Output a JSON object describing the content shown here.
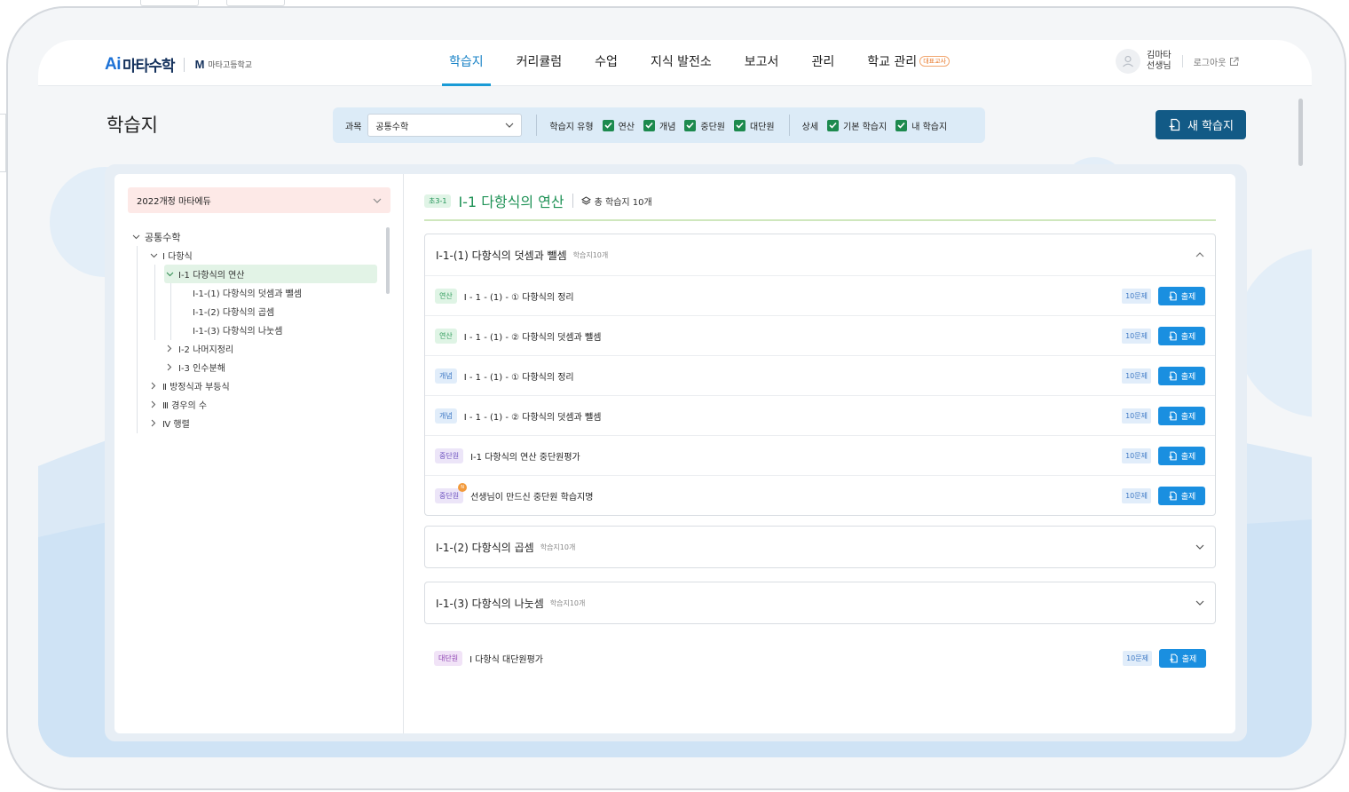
{
  "brand": {
    "logo_ai": "Ai",
    "logo_name": "마타수학",
    "school_mark": "M",
    "school_name": "마타고등학교"
  },
  "nav": [
    {
      "label": "학습지",
      "active": true
    },
    {
      "label": "커리큘럼"
    },
    {
      "label": "수업"
    },
    {
      "label": "지식 발전소"
    },
    {
      "label": "보고서"
    },
    {
      "label": "관리"
    },
    {
      "label": "학교 관리",
      "badge": "대표교사"
    }
  ],
  "user": {
    "name_line1": "김마타",
    "name_line2": "선생님",
    "logout": "로그아웃"
  },
  "page": {
    "title": "학습지",
    "new_button": "새 학습지"
  },
  "filters": {
    "subject_label": "과목",
    "subject_value": "공통수학",
    "type_label": "학습지 유형",
    "types": [
      "연산",
      "개념",
      "중단원",
      "대단원"
    ],
    "detail_label": "상세",
    "details": [
      "기본 학습지",
      "내 학습지"
    ]
  },
  "sidebar": {
    "curriculum": "2022개정 마타에듀",
    "tree": [
      {
        "label": "공통수학",
        "level": 0,
        "state": "open"
      },
      {
        "label": "Ⅰ 다항식",
        "level": 1,
        "state": "open"
      },
      {
        "label": "Ⅰ-1 다항식의 연산",
        "level": 2,
        "state": "open",
        "selected": true
      },
      {
        "label": "Ⅰ-1-(1) 다항식의 덧셈과 뺄셈",
        "level": 3
      },
      {
        "label": "Ⅰ-1-(2) 다항식의 곱셈",
        "level": 3
      },
      {
        "label": "Ⅰ-1-(3) 다항식의 나눗셈",
        "level": 3
      },
      {
        "label": "Ⅰ-2 나머지정리",
        "level": 2,
        "state": "closed"
      },
      {
        "label": "Ⅰ-3 인수분해",
        "level": 2,
        "state": "closed"
      },
      {
        "label": "Ⅱ 방정식과 부등식",
        "level": 1,
        "state": "closed"
      },
      {
        "label": "Ⅲ 경우의 수",
        "level": 1,
        "state": "closed"
      },
      {
        "label": "Ⅳ 행렬",
        "level": 1,
        "state": "closed"
      }
    ]
  },
  "unit": {
    "grade_tag": "초3-1",
    "title": "Ⅰ-1 다항식의 연산",
    "total": "총 학습지 10개"
  },
  "sections": [
    {
      "title": "Ⅰ-1-(1) 다항식의 덧셈과 뺄셈",
      "count": "학습지10개",
      "expanded": true,
      "rows": [
        {
          "tag": "연산",
          "title": "Ⅰ - 1 - (1) - ① 다항식의 정리",
          "qcount": "10문제",
          "button": "출제"
        },
        {
          "tag": "연산",
          "title": "Ⅰ - 1 - (1) - ② 다항식의 덧셈과 뺄셈",
          "qcount": "10문제",
          "button": "출제"
        },
        {
          "tag": "개념",
          "title": "Ⅰ - 1 - (1) - ① 다항식의 정리",
          "qcount": "10문제",
          "button": "출제"
        },
        {
          "tag": "개념",
          "title": "Ⅰ - 1 - (1) - ② 다항식의 덧셈과 뺄셈",
          "qcount": "10문제",
          "button": "출제"
        },
        {
          "tag": "중단원",
          "title": "Ⅰ-1 다항식의 연산 중단원평가",
          "qcount": "10문제",
          "button": "출제"
        },
        {
          "tag": "중단원",
          "title": "선생님이 만드신 중단원 학습지명",
          "qcount": "10문제",
          "button": "출제",
          "new_badge": "N"
        }
      ]
    },
    {
      "title": "Ⅰ-1-(2) 다항식의 곱셈",
      "count": "학습지10개",
      "expanded": false
    },
    {
      "title": "Ⅰ-1-(3) 다항식의 나눗셈",
      "count": "학습지10개",
      "expanded": false
    }
  ],
  "standalone": {
    "tag": "대단원",
    "title": "Ⅰ 다항식 대단원평가",
    "qcount": "10문제",
    "button": "출제"
  },
  "colors": {
    "accent": "#1a9bd6",
    "primary_button": "#125a86",
    "unit_green": "#1f9256",
    "issue_button": "#1a8fe0"
  }
}
